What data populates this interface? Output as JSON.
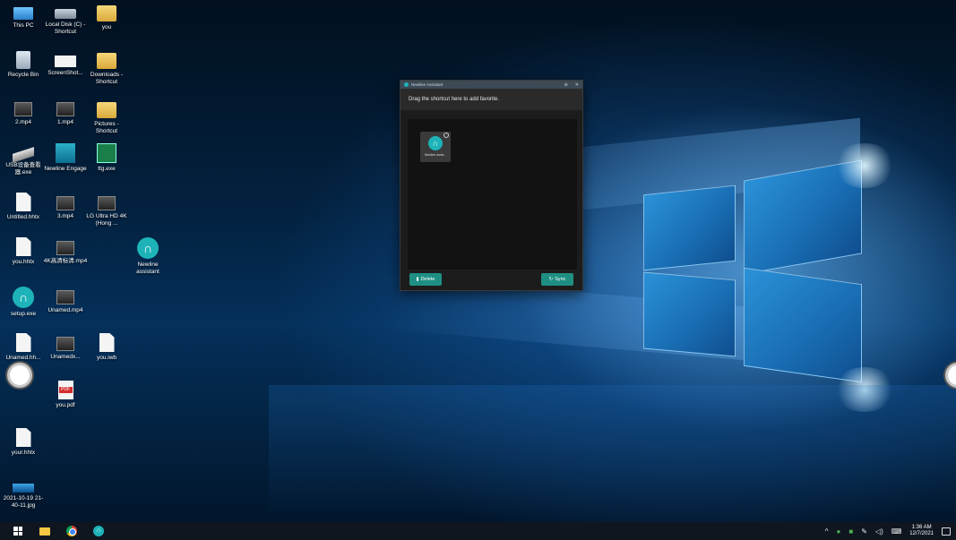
{
  "desktop": {
    "icons": [
      {
        "label": "This PC",
        "icon": "computer-icon"
      },
      {
        "label": "Local Disk (C) - Shortcut",
        "icon": "disk-icon"
      },
      {
        "label": "you",
        "icon": "folder-icon"
      },
      {
        "label": "Recycle Bin",
        "icon": "recycle-bin-icon"
      },
      {
        "label": "ScreenShot...",
        "icon": "screenshot-icon"
      },
      {
        "label": "Downloads - Shortcut",
        "icon": "folder-icon"
      },
      {
        "label": "2.mp4",
        "icon": "video-file-icon"
      },
      {
        "label": "1.mp4",
        "icon": "video-file-icon"
      },
      {
        "label": "Pictures - Shortcut",
        "icon": "folder-icon"
      },
      {
        "label": "USB设备查看器.exe",
        "icon": "usb-icon"
      },
      {
        "label": "Newline Engage",
        "icon": "engage-icon"
      },
      {
        "label": "ttg.exe",
        "icon": "ttg-icon"
      },
      {
        "label": "Untitled.hhtx",
        "icon": "document-icon"
      },
      {
        "label": "3.mp4",
        "icon": "video-file-icon"
      },
      {
        "label": "LG Ultra HD 4K (Hong ...",
        "icon": "video-file-icon"
      },
      {
        "label": "you.hhtx",
        "icon": "document-icon"
      },
      {
        "label": "4K高清标清.mp4",
        "icon": "video-file-icon"
      },
      {
        "label": "Newline assistant",
        "icon": "newline-icon"
      },
      {
        "label": "setup.exe",
        "icon": "newline-icon"
      },
      {
        "label": "Unamed.mp4",
        "icon": "video-file-icon"
      },
      {
        "label": "Unamed.hh...",
        "icon": "document-icon"
      },
      {
        "label": "Unamedx...",
        "icon": "video-file-icon"
      },
      {
        "label": "you.iwb",
        "icon": "document-icon"
      },
      {
        "label": "you.pdf",
        "icon": "pdf-icon"
      },
      {
        "label": "your.hhtx",
        "icon": "document-icon"
      },
      {
        "label": "2021-10-19 21-40-11.jpg",
        "icon": "image-file-icon"
      }
    ]
  },
  "assistant": {
    "title": "Newline Assistant",
    "minimize": "⊖",
    "close": "✕",
    "hint": "Drag the shortcut here to add favorite.",
    "favorite": {
      "label": "Newline assis..."
    },
    "delete_label": "Delete",
    "sync_label": "Sync"
  },
  "taskbar": {
    "time": "1:36 AM",
    "date": "12/7/2021"
  },
  "colors": {
    "accent": "#1db3b9",
    "button": "#1f8f83"
  }
}
